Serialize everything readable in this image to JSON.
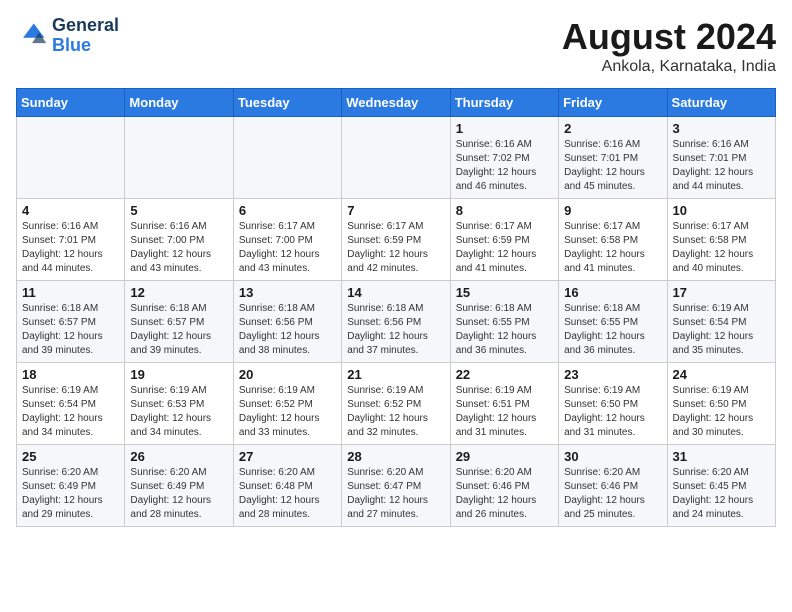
{
  "logo": {
    "line1": "General",
    "line2": "Blue"
  },
  "title": "August 2024",
  "subtitle": "Ankola, Karnataka, India",
  "weekdays": [
    "Sunday",
    "Monday",
    "Tuesday",
    "Wednesday",
    "Thursday",
    "Friday",
    "Saturday"
  ],
  "weeks": [
    [
      {
        "day": "",
        "info": ""
      },
      {
        "day": "",
        "info": ""
      },
      {
        "day": "",
        "info": ""
      },
      {
        "day": "",
        "info": ""
      },
      {
        "day": "1",
        "info": "Sunrise: 6:16 AM\nSunset: 7:02 PM\nDaylight: 12 hours\nand 46 minutes."
      },
      {
        "day": "2",
        "info": "Sunrise: 6:16 AM\nSunset: 7:01 PM\nDaylight: 12 hours\nand 45 minutes."
      },
      {
        "day": "3",
        "info": "Sunrise: 6:16 AM\nSunset: 7:01 PM\nDaylight: 12 hours\nand 44 minutes."
      }
    ],
    [
      {
        "day": "4",
        "info": "Sunrise: 6:16 AM\nSunset: 7:01 PM\nDaylight: 12 hours\nand 44 minutes."
      },
      {
        "day": "5",
        "info": "Sunrise: 6:16 AM\nSunset: 7:00 PM\nDaylight: 12 hours\nand 43 minutes."
      },
      {
        "day": "6",
        "info": "Sunrise: 6:17 AM\nSunset: 7:00 PM\nDaylight: 12 hours\nand 43 minutes."
      },
      {
        "day": "7",
        "info": "Sunrise: 6:17 AM\nSunset: 6:59 PM\nDaylight: 12 hours\nand 42 minutes."
      },
      {
        "day": "8",
        "info": "Sunrise: 6:17 AM\nSunset: 6:59 PM\nDaylight: 12 hours\nand 41 minutes."
      },
      {
        "day": "9",
        "info": "Sunrise: 6:17 AM\nSunset: 6:58 PM\nDaylight: 12 hours\nand 41 minutes."
      },
      {
        "day": "10",
        "info": "Sunrise: 6:17 AM\nSunset: 6:58 PM\nDaylight: 12 hours\nand 40 minutes."
      }
    ],
    [
      {
        "day": "11",
        "info": "Sunrise: 6:18 AM\nSunset: 6:57 PM\nDaylight: 12 hours\nand 39 minutes."
      },
      {
        "day": "12",
        "info": "Sunrise: 6:18 AM\nSunset: 6:57 PM\nDaylight: 12 hours\nand 39 minutes."
      },
      {
        "day": "13",
        "info": "Sunrise: 6:18 AM\nSunset: 6:56 PM\nDaylight: 12 hours\nand 38 minutes."
      },
      {
        "day": "14",
        "info": "Sunrise: 6:18 AM\nSunset: 6:56 PM\nDaylight: 12 hours\nand 37 minutes."
      },
      {
        "day": "15",
        "info": "Sunrise: 6:18 AM\nSunset: 6:55 PM\nDaylight: 12 hours\nand 36 minutes."
      },
      {
        "day": "16",
        "info": "Sunrise: 6:18 AM\nSunset: 6:55 PM\nDaylight: 12 hours\nand 36 minutes."
      },
      {
        "day": "17",
        "info": "Sunrise: 6:19 AM\nSunset: 6:54 PM\nDaylight: 12 hours\nand 35 minutes."
      }
    ],
    [
      {
        "day": "18",
        "info": "Sunrise: 6:19 AM\nSunset: 6:54 PM\nDaylight: 12 hours\nand 34 minutes."
      },
      {
        "day": "19",
        "info": "Sunrise: 6:19 AM\nSunset: 6:53 PM\nDaylight: 12 hours\nand 34 minutes."
      },
      {
        "day": "20",
        "info": "Sunrise: 6:19 AM\nSunset: 6:52 PM\nDaylight: 12 hours\nand 33 minutes."
      },
      {
        "day": "21",
        "info": "Sunrise: 6:19 AM\nSunset: 6:52 PM\nDaylight: 12 hours\nand 32 minutes."
      },
      {
        "day": "22",
        "info": "Sunrise: 6:19 AM\nSunset: 6:51 PM\nDaylight: 12 hours\nand 31 minutes."
      },
      {
        "day": "23",
        "info": "Sunrise: 6:19 AM\nSunset: 6:50 PM\nDaylight: 12 hours\nand 31 minutes."
      },
      {
        "day": "24",
        "info": "Sunrise: 6:19 AM\nSunset: 6:50 PM\nDaylight: 12 hours\nand 30 minutes."
      }
    ],
    [
      {
        "day": "25",
        "info": "Sunrise: 6:20 AM\nSunset: 6:49 PM\nDaylight: 12 hours\nand 29 minutes."
      },
      {
        "day": "26",
        "info": "Sunrise: 6:20 AM\nSunset: 6:49 PM\nDaylight: 12 hours\nand 28 minutes."
      },
      {
        "day": "27",
        "info": "Sunrise: 6:20 AM\nSunset: 6:48 PM\nDaylight: 12 hours\nand 28 minutes."
      },
      {
        "day": "28",
        "info": "Sunrise: 6:20 AM\nSunset: 6:47 PM\nDaylight: 12 hours\nand 27 minutes."
      },
      {
        "day": "29",
        "info": "Sunrise: 6:20 AM\nSunset: 6:46 PM\nDaylight: 12 hours\nand 26 minutes."
      },
      {
        "day": "30",
        "info": "Sunrise: 6:20 AM\nSunset: 6:46 PM\nDaylight: 12 hours\nand 25 minutes."
      },
      {
        "day": "31",
        "info": "Sunrise: 6:20 AM\nSunset: 6:45 PM\nDaylight: 12 hours\nand 24 minutes."
      }
    ]
  ]
}
